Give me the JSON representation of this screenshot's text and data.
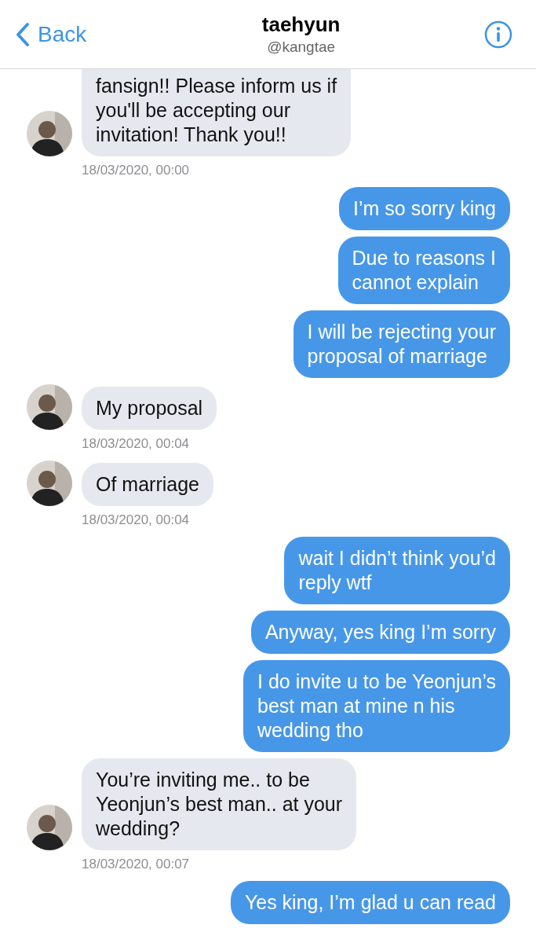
{
  "header": {
    "back": "Back",
    "title": "taehyun",
    "handle": "@kangtae"
  },
  "messages": [
    {
      "kind": "received",
      "lines": [
        "fansign!! Please inform us if",
        "you'll be accepting our",
        "invitation! Thank you!!"
      ],
      "time": "18/03/2020, 00:00"
    },
    {
      "kind": "sent",
      "lines": [
        "I’m so sorry king"
      ]
    },
    {
      "kind": "sent",
      "lines": [
        "Due to reasons I",
        "cannot explain"
      ]
    },
    {
      "kind": "sent",
      "lines": [
        "I will be rejecting your",
        "proposal of marriage"
      ]
    },
    {
      "kind": "received",
      "lines": [
        "My proposal"
      ],
      "time": "18/03/2020, 00:04"
    },
    {
      "kind": "received",
      "lines": [
        "Of marriage"
      ],
      "time": "18/03/2020, 00:04"
    },
    {
      "kind": "sent",
      "lines": [
        "wait I didn’t think you’d",
        "reply wtf"
      ]
    },
    {
      "kind": "sent",
      "lines": [
        "Anyway, yes king I’m sorry"
      ]
    },
    {
      "kind": "sent",
      "lines": [
        "I do invite u to be Yeonjun’s",
        "best man at mine n his",
        "wedding tho"
      ]
    },
    {
      "kind": "received",
      "lines": [
        "You’re inviting me.. to be",
        "Yeonjun’s best man.. at your",
        "wedding?"
      ],
      "time": "18/03/2020, 00:07"
    },
    {
      "kind": "sent",
      "lines": [
        "Yes king, I’m glad u can read"
      ]
    }
  ]
}
